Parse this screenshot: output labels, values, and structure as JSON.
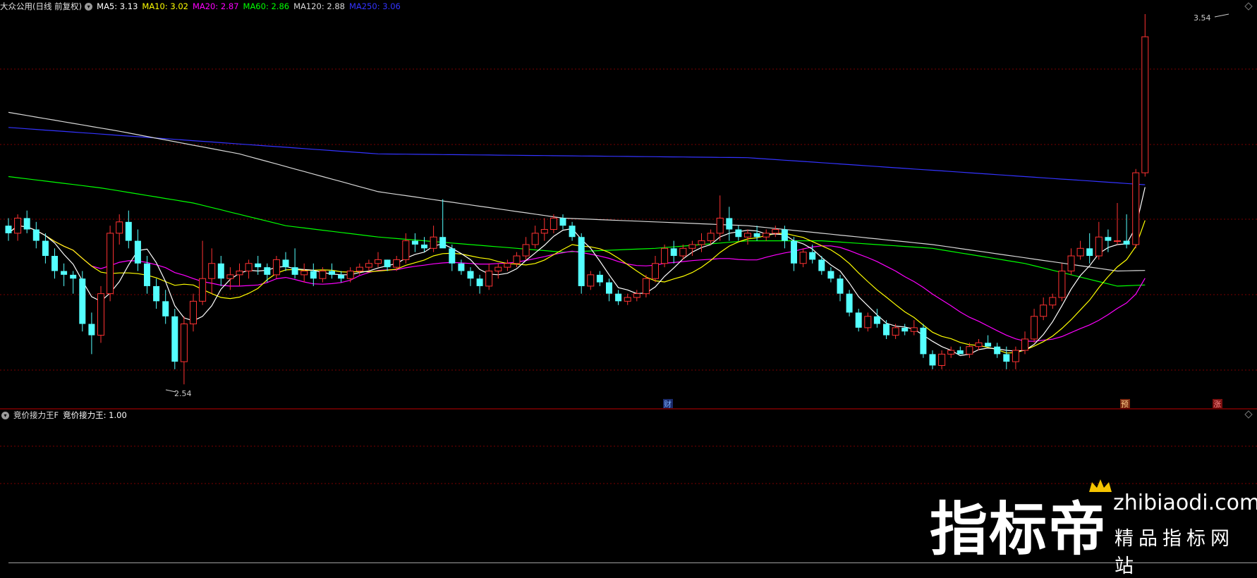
{
  "header": {
    "stock_label": "大众公用(日线 前复权)",
    "ma": [
      {
        "label": "MA5: 3.13",
        "color": "#ffffff"
      },
      {
        "label": "MA10: 3.02",
        "color": "#ffff00"
      },
      {
        "label": "MA20: 2.87",
        "color": "#ff00ff"
      },
      {
        "label": "MA60: 2.86",
        "color": "#00ff00"
      },
      {
        "label": "MA120: 2.88",
        "color": "#d8d8d8"
      },
      {
        "label": "MA250: 3.06",
        "color": "#3333ff"
      }
    ]
  },
  "indicator": {
    "name": "竞价接力王F",
    "value_label": "竞价接力王: 1.00"
  },
  "markers": {
    "high_label": "3.54",
    "low_label": "2.54",
    "event_badges": [
      {
        "label": "财",
        "color": "#3a78ff"
      },
      {
        "label": "预",
        "color": "#d04020"
      },
      {
        "label": "涨",
        "color": "#e03030"
      }
    ]
  },
  "colors": {
    "up": "#ff3232",
    "down": "#54ffff",
    "grid": "#7a0000",
    "divider": "#c00000"
  },
  "chart_data": {
    "type": "candlestick",
    "price_range": [
      2.54,
      3.54
    ],
    "candles": [
      [
        2.98,
        3.0,
        2.94,
        2.96
      ],
      [
        2.96,
        3.01,
        2.94,
        3.0
      ],
      [
        3.0,
        3.02,
        2.96,
        2.97
      ],
      [
        2.97,
        2.99,
        2.92,
        2.94
      ],
      [
        2.94,
        2.96,
        2.88,
        2.9
      ],
      [
        2.9,
        2.92,
        2.84,
        2.86
      ],
      [
        2.86,
        2.88,
        2.82,
        2.85
      ],
      [
        2.85,
        2.86,
        2.8,
        2.84
      ],
      [
        2.84,
        2.86,
        2.7,
        2.72
      ],
      [
        2.72,
        2.75,
        2.64,
        2.69
      ],
      [
        2.69,
        2.82,
        2.67,
        2.8
      ],
      [
        2.8,
        2.98,
        2.78,
        2.96
      ],
      [
        2.96,
        3.01,
        2.93,
        2.99
      ],
      [
        2.99,
        3.02,
        2.92,
        2.94
      ],
      [
        2.94,
        2.97,
        2.86,
        2.88
      ],
      [
        2.88,
        2.9,
        2.8,
        2.82
      ],
      [
        2.82,
        2.84,
        2.76,
        2.78
      ],
      [
        2.78,
        2.81,
        2.72,
        2.74
      ],
      [
        2.74,
        2.76,
        2.6,
        2.62
      ],
      [
        2.62,
        2.74,
        2.56,
        2.72
      ],
      [
        2.72,
        2.8,
        2.7,
        2.78
      ],
      [
        2.78,
        2.94,
        2.77,
        2.84
      ],
      [
        2.84,
        2.92,
        2.8,
        2.88
      ],
      [
        2.88,
        2.9,
        2.82,
        2.84
      ],
      [
        2.84,
        2.87,
        2.81,
        2.85
      ],
      [
        2.85,
        2.88,
        2.82,
        2.86
      ],
      [
        2.86,
        2.89,
        2.84,
        2.88
      ],
      [
        2.88,
        2.9,
        2.85,
        2.87
      ],
      [
        2.87,
        2.88,
        2.83,
        2.85
      ],
      [
        2.85,
        2.9,
        2.84,
        2.89
      ],
      [
        2.89,
        2.91,
        2.86,
        2.87
      ],
      [
        2.87,
        2.92,
        2.84,
        2.85
      ],
      [
        2.85,
        2.88,
        2.83,
        2.86
      ],
      [
        2.86,
        2.88,
        2.82,
        2.84
      ],
      [
        2.84,
        2.87,
        2.83,
        2.86
      ],
      [
        2.86,
        2.88,
        2.84,
        2.85
      ],
      [
        2.85,
        2.86,
        2.83,
        2.84
      ],
      [
        2.84,
        2.87,
        2.83,
        2.86
      ],
      [
        2.86,
        2.88,
        2.85,
        2.87
      ],
      [
        2.87,
        2.89,
        2.86,
        2.88
      ],
      [
        2.88,
        2.91,
        2.87,
        2.89
      ],
      [
        2.89,
        2.89,
        2.86,
        2.87
      ],
      [
        2.87,
        2.9,
        2.86,
        2.89
      ],
      [
        2.89,
        2.96,
        2.88,
        2.94
      ],
      [
        2.94,
        2.96,
        2.91,
        2.93
      ],
      [
        2.93,
        2.95,
        2.91,
        2.92
      ],
      [
        2.92,
        2.98,
        2.91,
        2.95
      ],
      [
        2.95,
        3.05,
        2.93,
        2.92
      ],
      [
        2.92,
        2.93,
        2.86,
        2.88
      ],
      [
        2.88,
        2.89,
        2.85,
        2.86
      ],
      [
        2.86,
        2.87,
        2.82,
        2.84
      ],
      [
        2.84,
        2.85,
        2.8,
        2.82
      ],
      [
        2.82,
        2.88,
        2.81,
        2.86
      ],
      [
        2.86,
        2.88,
        2.84,
        2.87
      ],
      [
        2.87,
        2.89,
        2.86,
        2.88
      ],
      [
        2.88,
        2.91,
        2.87,
        2.9
      ],
      [
        2.9,
        2.95,
        2.89,
        2.93
      ],
      [
        2.93,
        2.98,
        2.92,
        2.96
      ],
      [
        2.96,
        3.0,
        2.94,
        2.97
      ],
      [
        2.97,
        3.01,
        2.96,
        3.0
      ],
      [
        3.0,
        3.01,
        2.97,
        2.98
      ],
      [
        2.98,
        2.99,
        2.94,
        2.95
      ],
      [
        2.95,
        2.96,
        2.8,
        2.82
      ],
      [
        2.82,
        2.86,
        2.81,
        2.85
      ],
      [
        2.85,
        2.86,
        2.82,
        2.83
      ],
      [
        2.83,
        2.84,
        2.78,
        2.8
      ],
      [
        2.8,
        2.81,
        2.77,
        2.78
      ],
      [
        2.78,
        2.8,
        2.77,
        2.79
      ],
      [
        2.79,
        2.81,
        2.78,
        2.8
      ],
      [
        2.8,
        2.85,
        2.79,
        2.84
      ],
      [
        2.84,
        2.9,
        2.83,
        2.88
      ],
      [
        2.88,
        2.93,
        2.87,
        2.92
      ],
      [
        2.92,
        2.94,
        2.88,
        2.9
      ],
      [
        2.9,
        2.93,
        2.89,
        2.92
      ],
      [
        2.92,
        2.94,
        2.9,
        2.93
      ],
      [
        2.93,
        2.96,
        2.91,
        2.94
      ],
      [
        2.94,
        2.97,
        2.93,
        2.96
      ],
      [
        2.96,
        3.06,
        2.94,
        3.0
      ],
      [
        3.0,
        3.03,
        2.94,
        2.97
      ],
      [
        2.97,
        2.98,
        2.94,
        2.95
      ],
      [
        2.95,
        2.97,
        2.93,
        2.96
      ],
      [
        2.96,
        2.98,
        2.94,
        2.95
      ],
      [
        2.95,
        2.97,
        2.94,
        2.96
      ],
      [
        2.96,
        2.98,
        2.95,
        2.97
      ],
      [
        2.97,
        2.98,
        2.92,
        2.94
      ],
      [
        2.94,
        2.95,
        2.86,
        2.88
      ],
      [
        2.88,
        2.92,
        2.87,
        2.91
      ],
      [
        2.91,
        2.93,
        2.88,
        2.89
      ],
      [
        2.89,
        2.9,
        2.85,
        2.86
      ],
      [
        2.86,
        2.87,
        2.83,
        2.84
      ],
      [
        2.84,
        2.85,
        2.78,
        2.8
      ],
      [
        2.8,
        2.81,
        2.74,
        2.75
      ],
      [
        2.75,
        2.76,
        2.7,
        2.71
      ],
      [
        2.71,
        2.75,
        2.7,
        2.74
      ],
      [
        2.74,
        2.76,
        2.71,
        2.72
      ],
      [
        2.72,
        2.73,
        2.68,
        2.69
      ],
      [
        2.69,
        2.72,
        2.68,
        2.71
      ],
      [
        2.71,
        2.72,
        2.69,
        2.7
      ],
      [
        2.7,
        2.73,
        2.69,
        2.71
      ],
      [
        2.71,
        2.72,
        2.63,
        2.64
      ],
      [
        2.64,
        2.65,
        2.6,
        2.61
      ],
      [
        2.61,
        2.65,
        2.6,
        2.64
      ],
      [
        2.64,
        2.66,
        2.63,
        2.65
      ],
      [
        2.65,
        2.66,
        2.64,
        2.64
      ],
      [
        2.64,
        2.67,
        2.63,
        2.66
      ],
      [
        2.66,
        2.68,
        2.65,
        2.67
      ],
      [
        2.67,
        2.69,
        2.66,
        2.66
      ],
      [
        2.66,
        2.67,
        2.63,
        2.64
      ],
      [
        2.64,
        2.66,
        2.6,
        2.62
      ],
      [
        2.62,
        2.66,
        2.6,
        2.65
      ],
      [
        2.65,
        2.7,
        2.64,
        2.68
      ],
      [
        2.68,
        2.76,
        2.67,
        2.74
      ],
      [
        2.74,
        2.79,
        2.73,
        2.77
      ],
      [
        2.77,
        2.8,
        2.76,
        2.79
      ],
      [
        2.79,
        2.88,
        2.78,
        2.86
      ],
      [
        2.86,
        2.92,
        2.85,
        2.9
      ],
      [
        2.9,
        2.94,
        2.89,
        2.92
      ],
      [
        2.92,
        2.96,
        2.88,
        2.9
      ],
      [
        2.9,
        2.99,
        2.89,
        2.95
      ],
      [
        2.95,
        2.97,
        2.91,
        2.94
      ],
      [
        2.94,
        3.04,
        2.93,
        2.94
      ],
      [
        2.94,
        3.01,
        2.92,
        2.93
      ],
      [
        2.93,
        3.13,
        2.92,
        3.12
      ],
      [
        3.12,
        3.54,
        3.11,
        3.48
      ]
    ],
    "ma_lines": [
      {
        "key": "ma250",
        "color": "#3333ff",
        "values": [
          [
            0,
            3.24
          ],
          [
            40,
            3.17
          ],
          [
            80,
            3.16
          ],
          [
            140,
            3.06
          ]
        ]
      },
      {
        "key": "ma120",
        "color": "#d8d8d8",
        "values": [
          [
            0,
            3.28
          ],
          [
            12,
            3.23
          ],
          [
            25,
            3.17
          ],
          [
            40,
            3.07
          ],
          [
            60,
            3.0
          ],
          [
            80,
            2.98
          ],
          [
            100,
            2.93
          ],
          [
            120,
            2.86
          ],
          [
            140,
            2.87
          ]
        ]
      },
      {
        "key": "ma60",
        "color": "#00ff00",
        "values": [
          [
            0,
            3.11
          ],
          [
            10,
            3.08
          ],
          [
            20,
            3.04
          ],
          [
            30,
            2.98
          ],
          [
            40,
            2.95
          ],
          [
            50,
            2.93
          ],
          [
            60,
            2.91
          ],
          [
            70,
            2.92
          ],
          [
            80,
            2.94
          ],
          [
            88,
            2.94
          ],
          [
            100,
            2.92
          ],
          [
            110,
            2.88
          ],
          [
            120,
            2.82
          ],
          [
            130,
            2.83
          ],
          [
            140,
            2.86
          ]
        ]
      }
    ],
    "indicator_series": [
      [
        0,
        0
      ],
      [
        136,
        0
      ],
      [
        139,
        0.25
      ],
      [
        140,
        1.0
      ]
    ]
  }
}
